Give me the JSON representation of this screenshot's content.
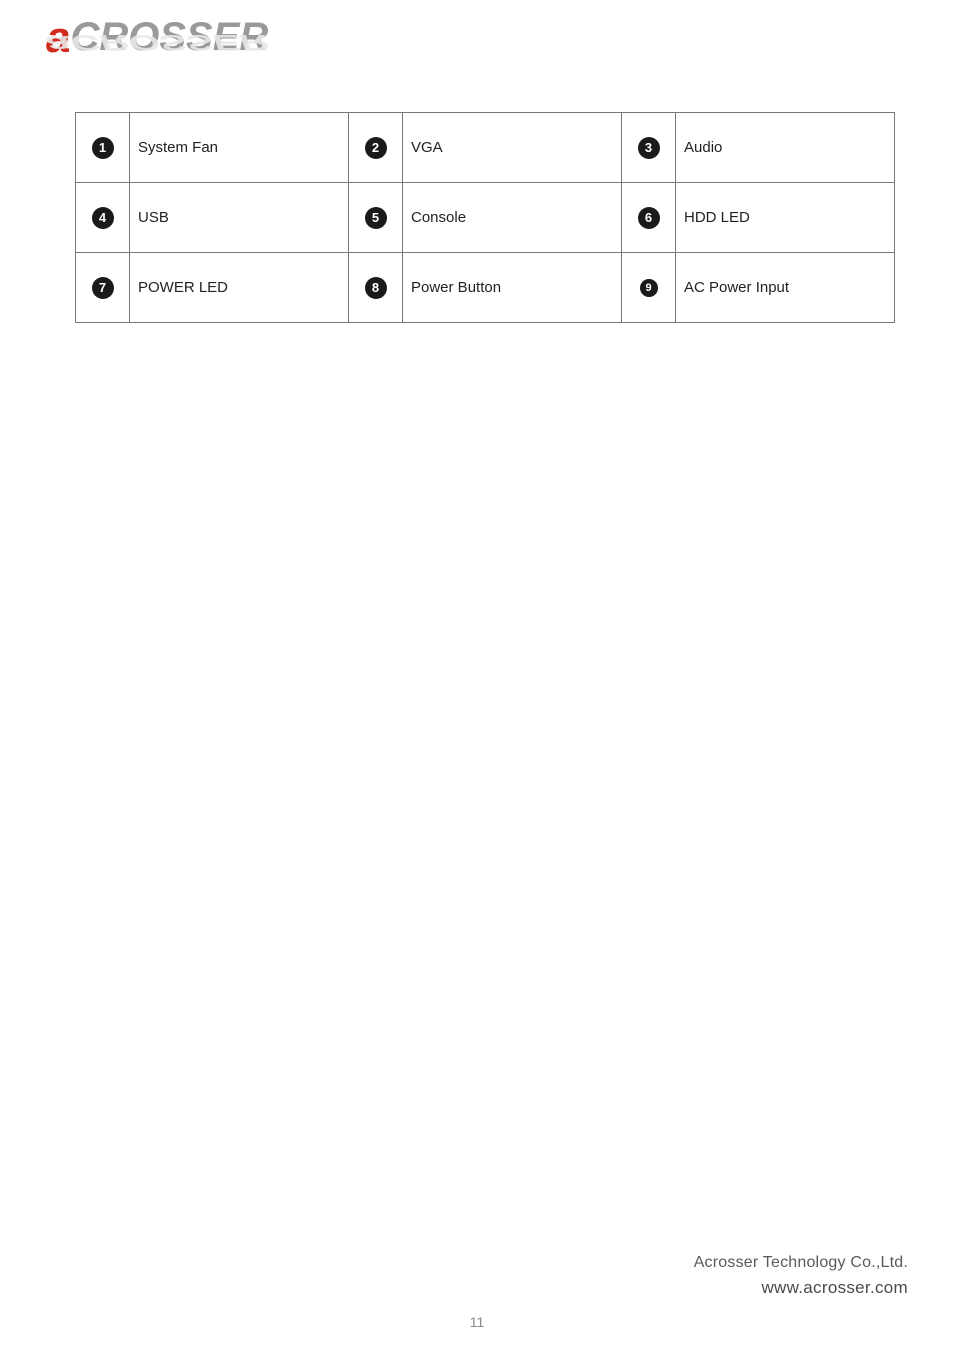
{
  "logo": {
    "text_a": "a",
    "text_rest": "CROSSER",
    "shadow_a": "a",
    "shadow_rest": "CROSSER"
  },
  "table": {
    "rows": [
      [
        {
          "num": "1",
          "label": "System Fan"
        },
        {
          "num": "2",
          "label": "VGA"
        },
        {
          "num": "3",
          "label": "Audio"
        }
      ],
      [
        {
          "num": "4",
          "label": "USB"
        },
        {
          "num": "5",
          "label": "Console"
        },
        {
          "num": "6",
          "label": "HDD LED"
        }
      ],
      [
        {
          "num": "7",
          "label": "POWER LED"
        },
        {
          "num": "8",
          "label": "Power Button"
        },
        {
          "num": "9",
          "label": "AC Power Input"
        }
      ]
    ]
  },
  "footer": {
    "company": "Acrosser Technology Co.,Ltd.",
    "url": "www.acrosser.com"
  },
  "page_number": "11"
}
